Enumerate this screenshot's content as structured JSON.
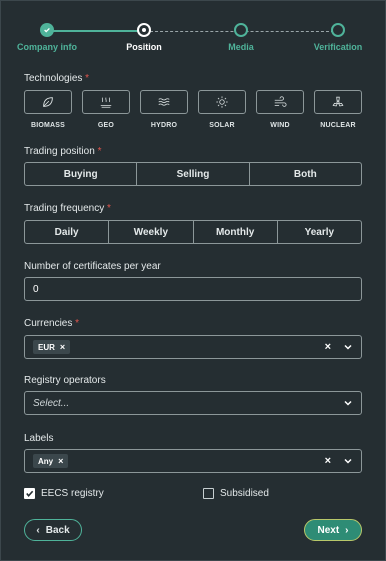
{
  "stepper": {
    "steps": [
      {
        "label": "Company info",
        "state": "done"
      },
      {
        "label": "Position",
        "state": "current"
      },
      {
        "label": "Media",
        "state": "todo"
      },
      {
        "label": "Verification",
        "state": "todo"
      }
    ]
  },
  "technologies": {
    "label": "Technologies",
    "required_mark": "*",
    "items": [
      {
        "label": "BIOMASS",
        "icon": "leaf-icon"
      },
      {
        "label": "GEO",
        "icon": "geothermal-icon"
      },
      {
        "label": "HYDRO",
        "icon": "waves-icon"
      },
      {
        "label": "SOLAR",
        "icon": "sun-icon"
      },
      {
        "label": "WIND",
        "icon": "wind-icon"
      },
      {
        "label": "NUCLEAR",
        "icon": "radiation-icon"
      }
    ]
  },
  "trading_position": {
    "label": "Trading position",
    "required_mark": "*",
    "options": [
      "Buying",
      "Selling",
      "Both"
    ]
  },
  "trading_frequency": {
    "label": "Trading frequency",
    "required_mark": "*",
    "options": [
      "Daily",
      "Weekly",
      "Monthly",
      "Yearly"
    ]
  },
  "certificates": {
    "label": "Number of certificates per year",
    "value": "0"
  },
  "currencies": {
    "label": "Currencies",
    "required_mark": "*",
    "chips": [
      "EUR"
    ],
    "chip_remove": "×",
    "clear": "×"
  },
  "registry_operators": {
    "label": "Registry operators",
    "placeholder": "Select..."
  },
  "labels": {
    "label": "Labels",
    "chips": [
      "Any"
    ],
    "chip_remove": "×",
    "clear": "×"
  },
  "checkboxes": {
    "eecs": {
      "label": "EECS registry",
      "checked": true
    },
    "subsidised": {
      "label": "Subsidised",
      "checked": false
    }
  },
  "footer": {
    "back_label": "Back",
    "back_icon": "‹",
    "next_label": "Next",
    "next_icon": "›"
  },
  "colors": {
    "background": "#252e32",
    "accent": "#4fb39a",
    "next_button": "#2e8c75",
    "required": "#e0554d"
  }
}
